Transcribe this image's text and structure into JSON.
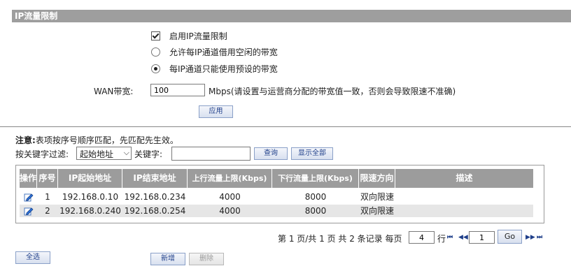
{
  "section": {
    "title": "IP流量限制"
  },
  "options": {
    "enable_label": "启用IP流量限制",
    "borrow_label": "允许每IP通道借用空闲的带宽",
    "preset_label": "每IP通道只能使用预设的带宽",
    "selected": "preset"
  },
  "wan": {
    "label": "WAN带宽:",
    "value": "100",
    "unit_note": "Mbps(请设置与运营商分配的带宽值一致，否则会导致限速不准确)"
  },
  "apply_label": "应用",
  "note": {
    "bold": "注意:",
    "text": "表项按序号顺序匹配，先匹配先生效。"
  },
  "filter": {
    "label": "按关键字过滤:",
    "select_value": "起始地址",
    "keyword_label": "关键字:",
    "keyword_value": "",
    "search_label": "查询",
    "show_all_label": "显示全部"
  },
  "table": {
    "headers": [
      "操作",
      "序号",
      "IP起始地址",
      "IP结束地址",
      "上行流量上限(Kbps)",
      "下行流量上限(Kbps)",
      "限速方向",
      "描述"
    ],
    "rows": [
      {
        "index": "1",
        "start": "192.168.0.10",
        "end": "192.168.0.234",
        "up": "4000",
        "down": "8000",
        "direction": "双向限速",
        "desc": ""
      },
      {
        "index": "2",
        "start": "192.168.0.240",
        "end": "192.168.0.254",
        "up": "4000",
        "down": "8000",
        "direction": "双向限速",
        "desc": ""
      }
    ]
  },
  "pager": {
    "summary": "第 1 页/共 1 页 共 2 条记录 每页",
    "per_page": "4",
    "row_unit": "行",
    "goto_value": "1",
    "go_label": "Go",
    "first": "⏮",
    "prev": "◀◀",
    "next": "▶▶",
    "last": "⏭"
  },
  "actions": {
    "select_all": "全选",
    "add": "新增",
    "delete": "删除"
  },
  "colors": {
    "header_gray": "#9e9e9e",
    "table_header": "#9c9c9c",
    "row_alt": "#e6e6e6",
    "link_blue": "#1f3f8a"
  }
}
